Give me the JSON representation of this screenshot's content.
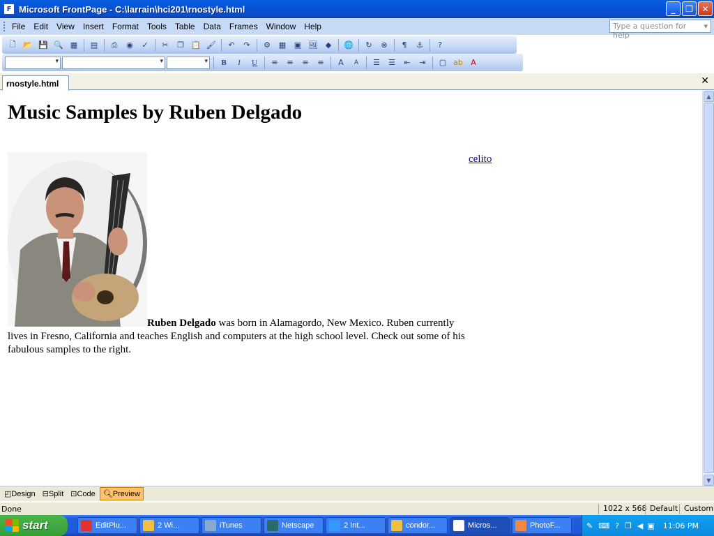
{
  "window": {
    "title": "Microsoft FrontPage - C:\\larrain\\hci201\\rnostyle.html"
  },
  "menu": {
    "items": [
      "File",
      "Edit",
      "View",
      "Insert",
      "Format",
      "Tools",
      "Table",
      "Data",
      "Frames",
      "Window",
      "Help"
    ],
    "help_placeholder": "Type a question for help"
  },
  "document": {
    "tab": "rnostyle.html",
    "heading": "Music Samples by Ruben Delgado",
    "link": "celito",
    "bold_name": "Ruben Delgado",
    "paragraph_rest": " was born in Alamagordo, New Mexico. Ruben currently lives in Fresno, California and teaches English and computers at the high school level. Check out some of his fabulous samples to the right."
  },
  "viewtabs": [
    "Design",
    "Split",
    "Code",
    "Preview"
  ],
  "status": {
    "text": "Done",
    "size": "1022 x 568",
    "mode1": "Default",
    "mode2": "Custom"
  },
  "taskbar": {
    "start": "start",
    "tasks": [
      "EditPlu...",
      "2 Wi...",
      "iTunes",
      "Netscape",
      "2 Int...",
      "condor...",
      "Micros...",
      "PhotoF..."
    ],
    "clock": "11:06 PM"
  }
}
